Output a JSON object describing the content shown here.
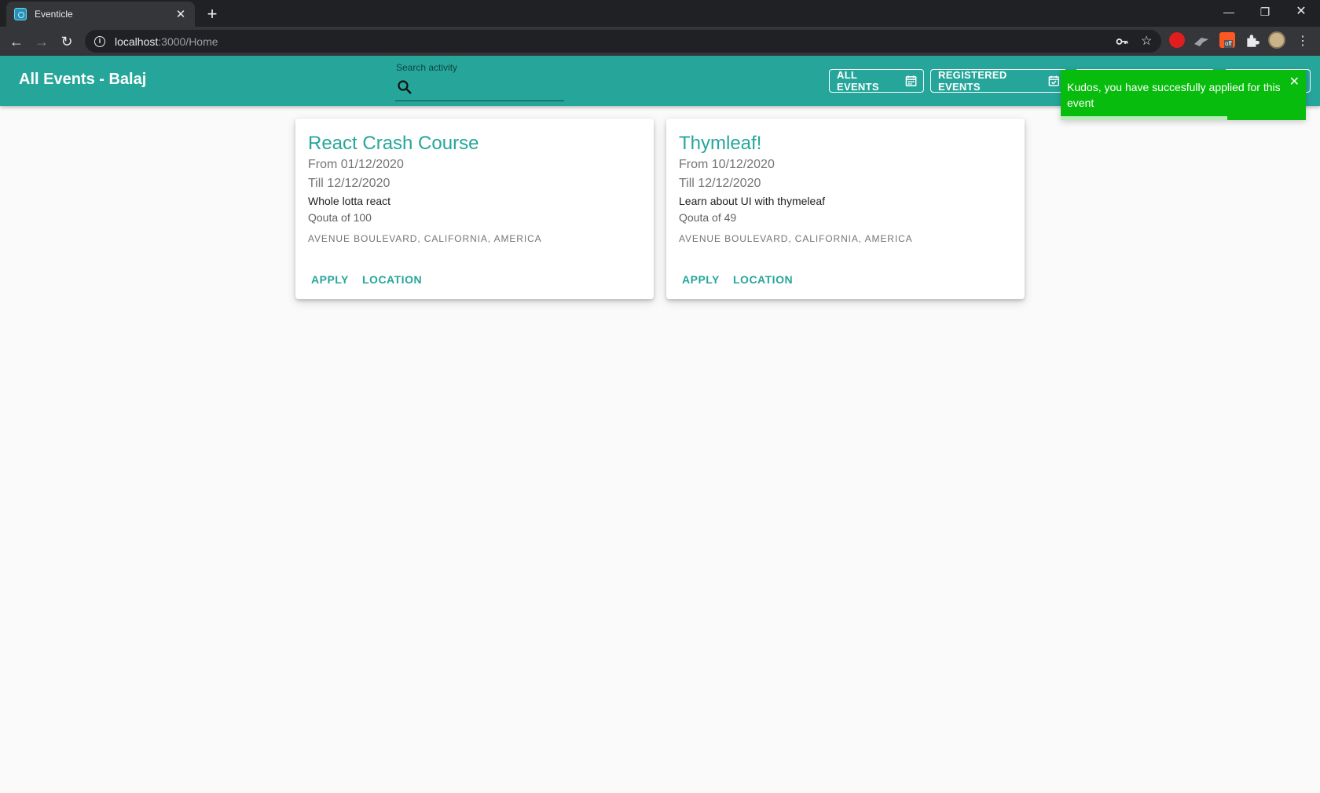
{
  "browser": {
    "tab_title": "Eventicle",
    "tab_close": "✕",
    "new_tab": "+",
    "url_host": "localhost",
    "url_path": ":3000/Home",
    "window_minimize": "—",
    "window_restore": "❐",
    "window_close": "✕",
    "ext_badge": "off"
  },
  "appbar": {
    "title": "All Events - Balaj",
    "search_label": "Search activity",
    "search_value": "",
    "nav_all_events": "ALL EVENTS",
    "nav_registered_events": "REGISTERED EVENTS"
  },
  "toast": {
    "message": "Kudos, you have succesfully applied for this event",
    "close": "✕",
    "progress": 0.68,
    "color": "#07bc0c"
  },
  "events": [
    {
      "title": "React Crash Course",
      "from": "From 01/12/2020",
      "till": "Till 12/12/2020",
      "description": "Whole lotta react",
      "quota": "Qouta of 100",
      "location": "AVENUE BOULEVARD, CALIFORNIA, AMERICA",
      "apply": "APPLY",
      "location_btn": "LOCATION"
    },
    {
      "title": "Thymleaf!",
      "from": "From 10/12/2020",
      "till": "Till 12/12/2020",
      "description": "Learn about UI with thymeleaf",
      "quota": "Qouta of 49",
      "location": "AVENUE BOULEVARD, CALIFORNIA, AMERICA",
      "apply": "APPLY",
      "location_btn": "LOCATION"
    }
  ],
  "colors": {
    "primary": "#26a69a",
    "toast": "#07bc0c"
  }
}
